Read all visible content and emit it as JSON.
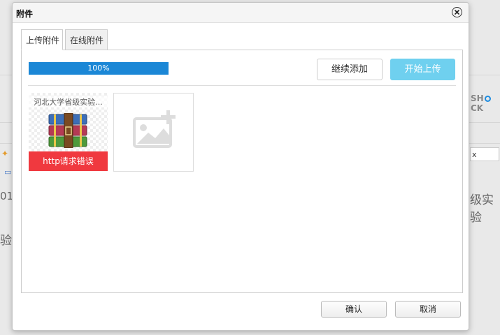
{
  "background": {
    "fragment_left_number": "01",
    "fragment_left_text": "验",
    "fragment_right_text": "级实验",
    "fragment_right_box": "x",
    "logo_left": "SH",
    "logo_right": "CK"
  },
  "dialog": {
    "title": "附件",
    "tabs": [
      {
        "label": "上传附件",
        "active": true
      },
      {
        "label": "在线附件",
        "active": false
      }
    ],
    "upload": {
      "progress_text": "100%",
      "progress_percent": 100,
      "add_more_label": "继续添加",
      "start_upload_label": "开始上传",
      "files": [
        {
          "name": "河北大学省级实验...",
          "status": "http请求错误"
        }
      ]
    },
    "footer": {
      "ok_label": "确认",
      "cancel_label": "取消"
    }
  },
  "colors": {
    "progress": "#1b87d6",
    "start_button": "#6fd0ef",
    "error": "#f0393f"
  }
}
